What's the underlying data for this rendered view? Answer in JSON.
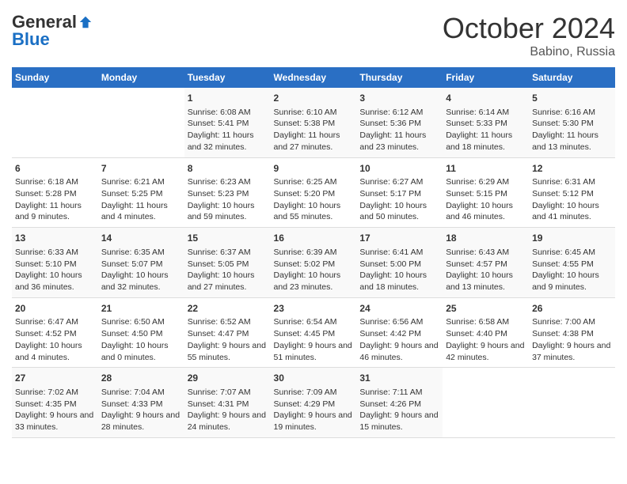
{
  "header": {
    "logo_general": "General",
    "logo_blue": "Blue",
    "title": "October 2024",
    "location": "Babino, Russia"
  },
  "days_of_week": [
    "Sunday",
    "Monday",
    "Tuesday",
    "Wednesday",
    "Thursday",
    "Friday",
    "Saturday"
  ],
  "weeks": [
    [
      {
        "day": "",
        "sunrise": "",
        "sunset": "",
        "daylight": ""
      },
      {
        "day": "",
        "sunrise": "",
        "sunset": "",
        "daylight": ""
      },
      {
        "day": "1",
        "sunrise": "Sunrise: 6:08 AM",
        "sunset": "Sunset: 5:41 PM",
        "daylight": "Daylight: 11 hours and 32 minutes."
      },
      {
        "day": "2",
        "sunrise": "Sunrise: 6:10 AM",
        "sunset": "Sunset: 5:38 PM",
        "daylight": "Daylight: 11 hours and 27 minutes."
      },
      {
        "day": "3",
        "sunrise": "Sunrise: 6:12 AM",
        "sunset": "Sunset: 5:36 PM",
        "daylight": "Daylight: 11 hours and 23 minutes."
      },
      {
        "day": "4",
        "sunrise": "Sunrise: 6:14 AM",
        "sunset": "Sunset: 5:33 PM",
        "daylight": "Daylight: 11 hours and 18 minutes."
      },
      {
        "day": "5",
        "sunrise": "Sunrise: 6:16 AM",
        "sunset": "Sunset: 5:30 PM",
        "daylight": "Daylight: 11 hours and 13 minutes."
      }
    ],
    [
      {
        "day": "6",
        "sunrise": "Sunrise: 6:18 AM",
        "sunset": "Sunset: 5:28 PM",
        "daylight": "Daylight: 11 hours and 9 minutes."
      },
      {
        "day": "7",
        "sunrise": "Sunrise: 6:21 AM",
        "sunset": "Sunset: 5:25 PM",
        "daylight": "Daylight: 11 hours and 4 minutes."
      },
      {
        "day": "8",
        "sunrise": "Sunrise: 6:23 AM",
        "sunset": "Sunset: 5:23 PM",
        "daylight": "Daylight: 10 hours and 59 minutes."
      },
      {
        "day": "9",
        "sunrise": "Sunrise: 6:25 AM",
        "sunset": "Sunset: 5:20 PM",
        "daylight": "Daylight: 10 hours and 55 minutes."
      },
      {
        "day": "10",
        "sunrise": "Sunrise: 6:27 AM",
        "sunset": "Sunset: 5:17 PM",
        "daylight": "Daylight: 10 hours and 50 minutes."
      },
      {
        "day": "11",
        "sunrise": "Sunrise: 6:29 AM",
        "sunset": "Sunset: 5:15 PM",
        "daylight": "Daylight: 10 hours and 46 minutes."
      },
      {
        "day": "12",
        "sunrise": "Sunrise: 6:31 AM",
        "sunset": "Sunset: 5:12 PM",
        "daylight": "Daylight: 10 hours and 41 minutes."
      }
    ],
    [
      {
        "day": "13",
        "sunrise": "Sunrise: 6:33 AM",
        "sunset": "Sunset: 5:10 PM",
        "daylight": "Daylight: 10 hours and 36 minutes."
      },
      {
        "day": "14",
        "sunrise": "Sunrise: 6:35 AM",
        "sunset": "Sunset: 5:07 PM",
        "daylight": "Daylight: 10 hours and 32 minutes."
      },
      {
        "day": "15",
        "sunrise": "Sunrise: 6:37 AM",
        "sunset": "Sunset: 5:05 PM",
        "daylight": "Daylight: 10 hours and 27 minutes."
      },
      {
        "day": "16",
        "sunrise": "Sunrise: 6:39 AM",
        "sunset": "Sunset: 5:02 PM",
        "daylight": "Daylight: 10 hours and 23 minutes."
      },
      {
        "day": "17",
        "sunrise": "Sunrise: 6:41 AM",
        "sunset": "Sunset: 5:00 PM",
        "daylight": "Daylight: 10 hours and 18 minutes."
      },
      {
        "day": "18",
        "sunrise": "Sunrise: 6:43 AM",
        "sunset": "Sunset: 4:57 PM",
        "daylight": "Daylight: 10 hours and 13 minutes."
      },
      {
        "day": "19",
        "sunrise": "Sunrise: 6:45 AM",
        "sunset": "Sunset: 4:55 PM",
        "daylight": "Daylight: 10 hours and 9 minutes."
      }
    ],
    [
      {
        "day": "20",
        "sunrise": "Sunrise: 6:47 AM",
        "sunset": "Sunset: 4:52 PM",
        "daylight": "Daylight: 10 hours and 4 minutes."
      },
      {
        "day": "21",
        "sunrise": "Sunrise: 6:50 AM",
        "sunset": "Sunset: 4:50 PM",
        "daylight": "Daylight: 10 hours and 0 minutes."
      },
      {
        "day": "22",
        "sunrise": "Sunrise: 6:52 AM",
        "sunset": "Sunset: 4:47 PM",
        "daylight": "Daylight: 9 hours and 55 minutes."
      },
      {
        "day": "23",
        "sunrise": "Sunrise: 6:54 AM",
        "sunset": "Sunset: 4:45 PM",
        "daylight": "Daylight: 9 hours and 51 minutes."
      },
      {
        "day": "24",
        "sunrise": "Sunrise: 6:56 AM",
        "sunset": "Sunset: 4:42 PM",
        "daylight": "Daylight: 9 hours and 46 minutes."
      },
      {
        "day": "25",
        "sunrise": "Sunrise: 6:58 AM",
        "sunset": "Sunset: 4:40 PM",
        "daylight": "Daylight: 9 hours and 42 minutes."
      },
      {
        "day": "26",
        "sunrise": "Sunrise: 7:00 AM",
        "sunset": "Sunset: 4:38 PM",
        "daylight": "Daylight: 9 hours and 37 minutes."
      }
    ],
    [
      {
        "day": "27",
        "sunrise": "Sunrise: 7:02 AM",
        "sunset": "Sunset: 4:35 PM",
        "daylight": "Daylight: 9 hours and 33 minutes."
      },
      {
        "day": "28",
        "sunrise": "Sunrise: 7:04 AM",
        "sunset": "Sunset: 4:33 PM",
        "daylight": "Daylight: 9 hours and 28 minutes."
      },
      {
        "day": "29",
        "sunrise": "Sunrise: 7:07 AM",
        "sunset": "Sunset: 4:31 PM",
        "daylight": "Daylight: 9 hours and 24 minutes."
      },
      {
        "day": "30",
        "sunrise": "Sunrise: 7:09 AM",
        "sunset": "Sunset: 4:29 PM",
        "daylight": "Daylight: 9 hours and 19 minutes."
      },
      {
        "day": "31",
        "sunrise": "Sunrise: 7:11 AM",
        "sunset": "Sunset: 4:26 PM",
        "daylight": "Daylight: 9 hours and 15 minutes."
      },
      {
        "day": "",
        "sunrise": "",
        "sunset": "",
        "daylight": ""
      },
      {
        "day": "",
        "sunrise": "",
        "sunset": "",
        "daylight": ""
      }
    ]
  ]
}
